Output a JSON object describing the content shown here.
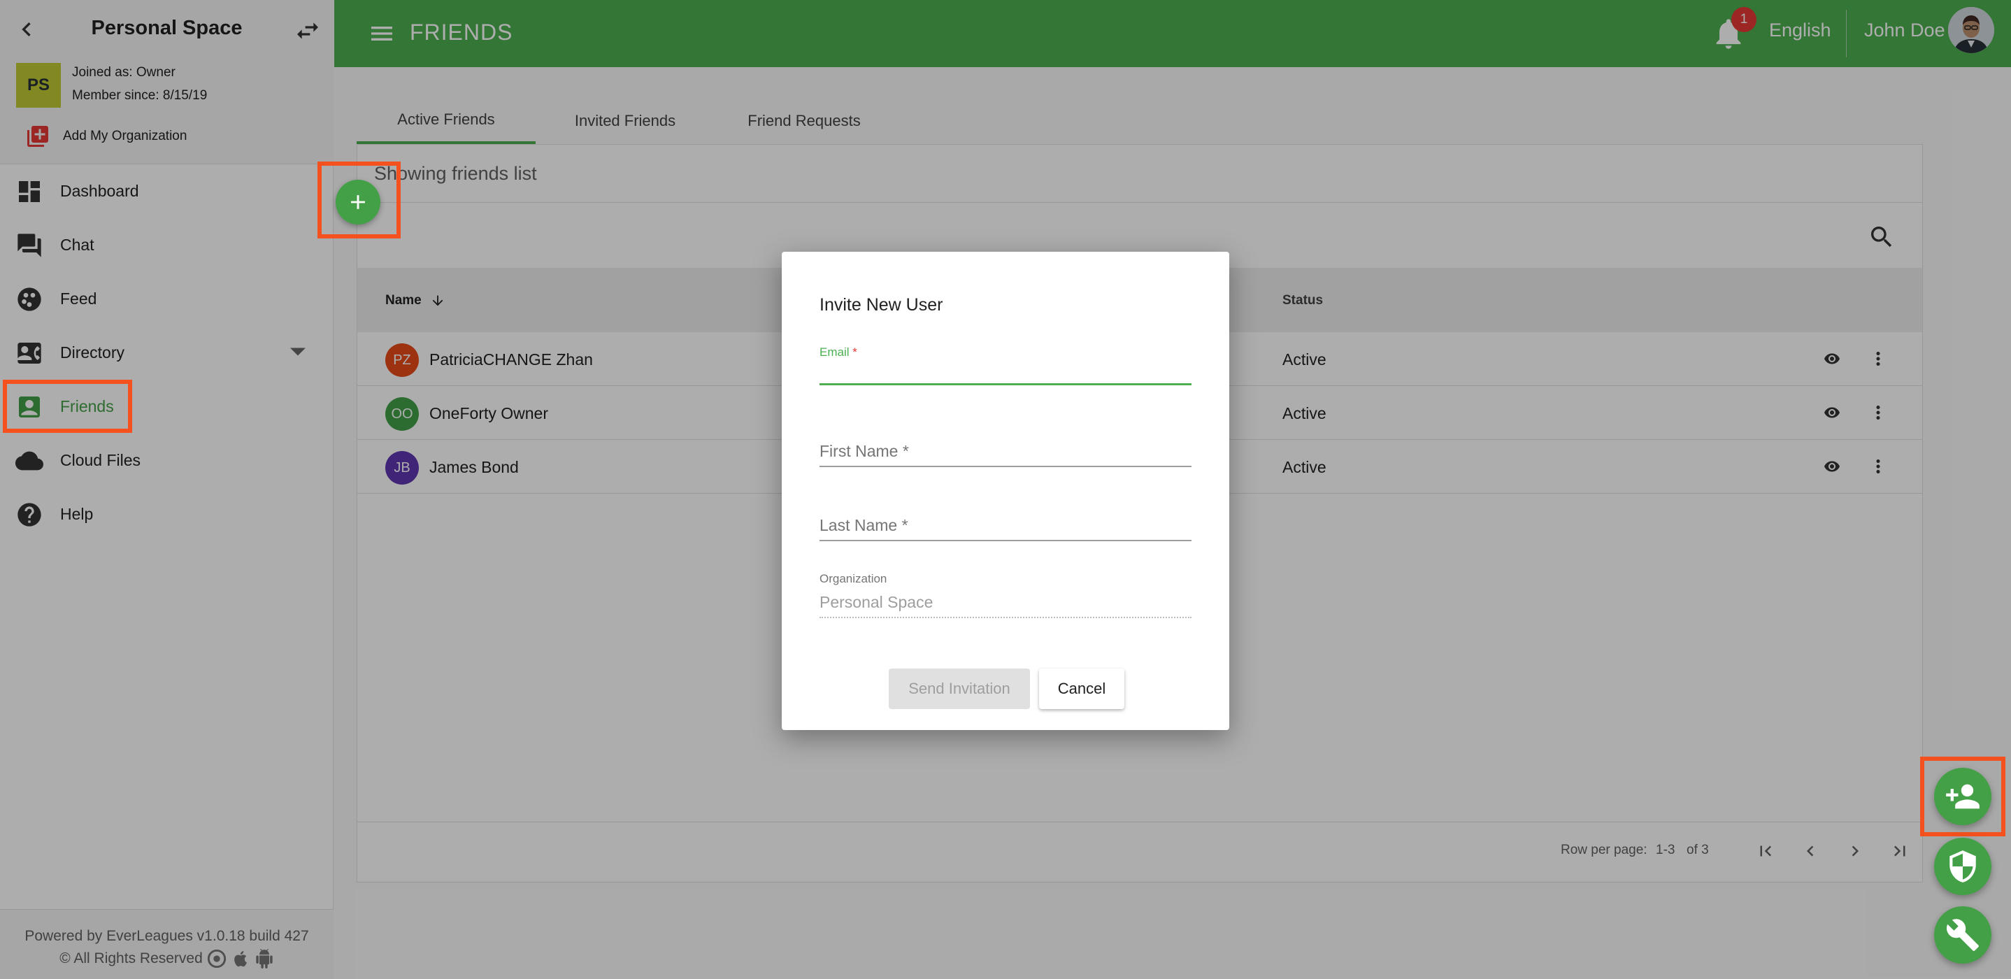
{
  "sidebar": {
    "space_title": "Personal Space",
    "avatar_initials": "PS",
    "joined_as": "Joined as: Owner",
    "member_since": "Member since: 8/15/19",
    "add_org_label": "Add My Organization",
    "nav": [
      {
        "label": "Dashboard",
        "icon": "dashboard-icon"
      },
      {
        "label": "Chat",
        "icon": "chat-icon"
      },
      {
        "label": "Feed",
        "icon": "feed-icon"
      },
      {
        "label": "Directory",
        "icon": "directory-icon"
      },
      {
        "label": "Friends",
        "icon": "friends-icon",
        "active": true
      },
      {
        "label": "Cloud Files",
        "icon": "cloud-icon"
      },
      {
        "label": "Help",
        "icon": "help-icon"
      }
    ],
    "footer_powered": "Powered by EverLeagues v1.0.18 build 427",
    "footer_rights": "© All Rights Reserved"
  },
  "topbar": {
    "title": "FRIENDS",
    "notification_count": "1",
    "language": "English",
    "user_name": "John Doe"
  },
  "tabs": [
    "Active Friends",
    "Invited Friends",
    "Friend Requests"
  ],
  "list": {
    "subtitle": "Showing friends list",
    "columns": {
      "name": "Name",
      "status": "Status"
    },
    "rows": [
      {
        "initials": "PZ",
        "name": "PatriciaCHANGE Zhan",
        "status": "Active",
        "color": "#e64a19"
      },
      {
        "initials": "OO",
        "name": "OneForty Owner",
        "status": "Active",
        "color": "#43a047"
      },
      {
        "initials": "JB",
        "name": "James Bond",
        "status": "Active",
        "color": "#5e35b1"
      }
    ],
    "pager": {
      "label": "Row per page:",
      "range": "1-3",
      "of": "of 3"
    }
  },
  "dialog": {
    "title": "Invite New User",
    "email_label": "Email",
    "required_mark": "*",
    "first_name_placeholder": "First Name *",
    "last_name_placeholder": "Last Name *",
    "organization_label": "Organization",
    "organization_value": "Personal Space",
    "send_label": "Send Invitation",
    "cancel_label": "Cancel"
  },
  "colors": {
    "brand_green": "#4caf50",
    "highlight_orange": "#f4511e",
    "badge_red": "#e53935"
  }
}
